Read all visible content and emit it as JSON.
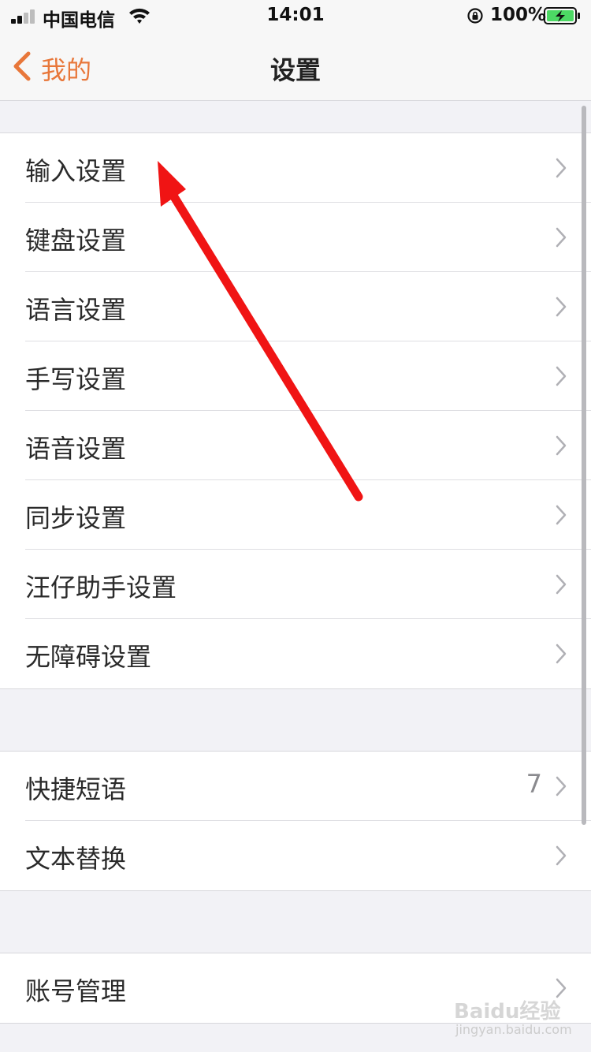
{
  "status_bar": {
    "carrier": "中国电信",
    "time": "14:01",
    "battery": "100%"
  },
  "nav": {
    "back_label": "我的",
    "title": "设置"
  },
  "groups": [
    {
      "items": [
        {
          "label": "输入设置"
        },
        {
          "label": "键盘设置"
        },
        {
          "label": "语言设置"
        },
        {
          "label": "手写设置"
        },
        {
          "label": "语音设置"
        },
        {
          "label": "同步设置"
        },
        {
          "label": "汪仔助手设置"
        },
        {
          "label": "无障碍设置"
        }
      ]
    },
    {
      "items": [
        {
          "label": "快捷短语",
          "value": "7"
        },
        {
          "label": "文本替换"
        }
      ]
    },
    {
      "items": [
        {
          "label": "账号管理"
        }
      ]
    }
  ],
  "colors": {
    "accent": "#e8773a",
    "annotation": "#f01414"
  },
  "watermark": {
    "logo": "Baidu经验",
    "url": "jingyan.baidu.com"
  }
}
